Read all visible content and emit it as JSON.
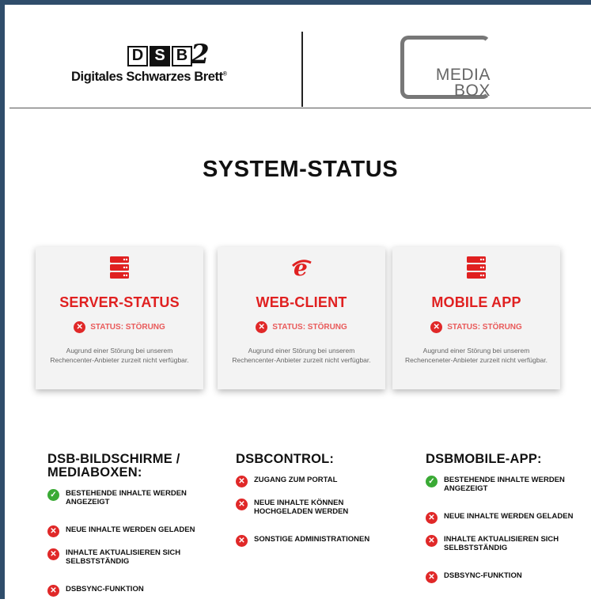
{
  "header": {
    "dsb_letters": [
      "D",
      "S",
      "B"
    ],
    "dsb_number": "2",
    "dsb_subtitle": "Digitales Schwarzes Brett",
    "dsb_reg": "®",
    "mediabox_line1": "MEDIA",
    "mediabox_line2": "BOX"
  },
  "page_title": "SYSTEM-STATUS",
  "colors": {
    "accent_red": "#e02020",
    "status_red": "#e02828",
    "ok_green": "#3aaa35",
    "frame_blue": "#2f4d6b"
  },
  "cards": [
    {
      "icon": "server-icon",
      "title": "SERVER-STATUS",
      "status": "STATUS: STÖRUNG",
      "description": "Augrund einer Störung bei unserem Rechencenter-Anbieter zurzeit nicht verfügbar."
    },
    {
      "icon": "internet-explorer-icon",
      "title": "WEB-CLIENT",
      "status": "STATUS: STÖRUNG",
      "description": "Augrund einer Störung bei unserem Rechencenter-Anbieter zurzeit nicht verfügbar."
    },
    {
      "icon": "server-icon",
      "title": "MOBILE APP",
      "status": "STATUS: STÖRUNG",
      "description": "Augrund einer Störung bei unserem Rechenceneter-Anbieter zurzeit nicht verfügbar."
    }
  ],
  "columns": [
    {
      "title_line1": "DSB-BILDSCHIRME /",
      "title_line2": "MEDIABOXEN:",
      "items": [
        {
          "status": "ok",
          "line1": "BESTEHENDE INHALTE WERDEN",
          "line2": "ANGEZEIGT"
        },
        {
          "status": "error",
          "line1": "NEUE INHALTE WERDEN GELADEN",
          "line2": ""
        },
        {
          "status": "error",
          "line1": "INHALTE AKTUALISIEREN SICH",
          "line2": "SELBSTSTÄNDIG"
        },
        {
          "status": "error",
          "line1": "DSBSYNC-FUNKTION",
          "line2": ""
        }
      ]
    },
    {
      "title_line1": "DSBCONTROL:",
      "title_line2": "",
      "items": [
        {
          "status": "error",
          "line1": "ZUGANG ZUM PORTAL",
          "line2": ""
        },
        {
          "status": "error",
          "line1": "NEUE INHALTE KÖNNEN",
          "line2": "HOCHGELADEN WERDEN"
        },
        {
          "status": "error",
          "line1": "SONSTIGE ADMINISTRATIONEN",
          "line2": ""
        }
      ]
    },
    {
      "title_line1": "DSBMOBILE-APP:",
      "title_line2": "",
      "items": [
        {
          "status": "ok",
          "line1": "BESTEHENDE INHALTE WERDEN",
          "line2": "ANGEZEIGT"
        },
        {
          "status": "error",
          "line1": "NEUE INHALTE WERDEN GELADEN",
          "line2": ""
        },
        {
          "status": "error",
          "line1": "INHALTE AKTUALISIEREN SICH",
          "line2": "SELBSTSTÄNDIG"
        },
        {
          "status": "error",
          "line1": "DSBSYNC-FUNKTION",
          "line2": ""
        }
      ]
    }
  ]
}
